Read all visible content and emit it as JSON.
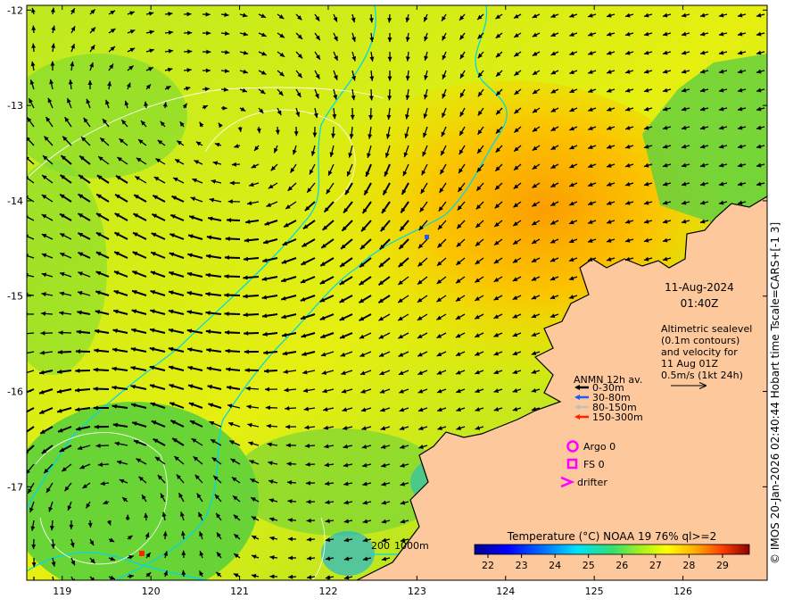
{
  "map": {
    "lon_ticks": [
      "119",
      "120",
      "121",
      "122",
      "123",
      "124",
      "125",
      "126"
    ],
    "lat_ticks": [
      "-12",
      "-13",
      "-14",
      "-15",
      "-16",
      "-17"
    ],
    "lon_range": [
      118.6,
      126.95
    ],
    "lat_range": [
      -11.95,
      -17.98
    ]
  },
  "info": {
    "date": "11-Aug-2024",
    "time": "01:40Z",
    "desc_lines": [
      "Altimetric sealevel",
      "(0.1m contours)",
      "and velocity for",
      "11 Aug 01Z"
    ],
    "scale_label": "0.5m/s (1kt 24h)"
  },
  "anmn_legend": {
    "title": "ANMN 12h av.",
    "items": [
      {
        "label": "0-30m",
        "color": "#000000"
      },
      {
        "label": "30-80m",
        "color": "#1e5cff"
      },
      {
        "label": "80-150m",
        "color": "#c0c0c0"
      },
      {
        "label": "150-300m",
        "color": "#ff2200"
      }
    ]
  },
  "markers": {
    "argo": "Argo 0",
    "fs": "FS 0",
    "drifter": "drifter",
    "color": "#ff00ff"
  },
  "bathymetry": {
    "label_200": "200",
    "label_1000": "1000m"
  },
  "colorbar": {
    "title": "Temperature (°C) NOAA 19 76% ql>=2",
    "ticks": [
      "22",
      "23",
      "24",
      "25",
      "26",
      "27",
      "28",
      "29"
    ],
    "range": [
      21.6,
      29.8
    ]
  },
  "credit": "© IMOS 20-Jan-2026 02:40:44 Hobart time Tscale=CARS+[-1 3]",
  "colors": {
    "land": "#fcc89c",
    "contour": "#00d8e8",
    "sealevel": "#ffffff"
  }
}
